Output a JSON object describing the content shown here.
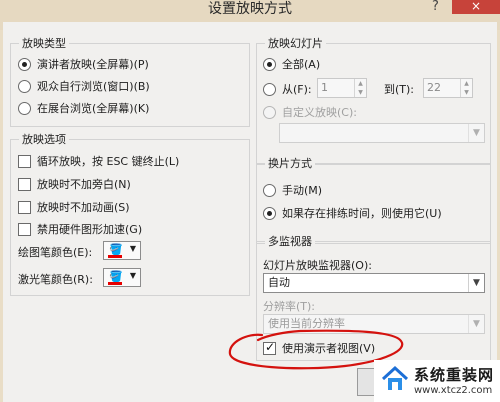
{
  "window": {
    "title": "设置放映方式",
    "help": "?",
    "close": "×"
  },
  "show_type": {
    "title": "放映类型",
    "options": [
      {
        "label": "演讲者放映(全屏幕)(P)",
        "selected": true
      },
      {
        "label": "观众自行浏览(窗口)(B)",
        "selected": false
      },
      {
        "label": "在展台浏览(全屏幕)(K)",
        "selected": false
      }
    ]
  },
  "show_options": {
    "title": "放映选项",
    "checks": [
      {
        "label": "循环放映，按 ESC 键终止(L)",
        "checked": false
      },
      {
        "label": "放映时不加旁白(N)",
        "checked": false
      },
      {
        "label": "放映时不加动画(S)",
        "checked": false
      },
      {
        "label": "禁用硬件图形加速(G)",
        "checked": false
      }
    ],
    "pen_color_label": "绘图笔颜色(E):",
    "laser_color_label": "激光笔颜色(R):",
    "pen_color": "#e60000",
    "laser_color": "#e60000"
  },
  "slides": {
    "title": "放映幻灯片",
    "all_label": "全部(A)",
    "from_label": "从(F):",
    "from_value": "1",
    "to_label": "到(T):",
    "to_value": "22",
    "custom_label": "自定义放映(C):",
    "custom_value": ""
  },
  "advance": {
    "title": "换片方式",
    "options": [
      {
        "label": "手动(M)",
        "selected": false
      },
      {
        "label": "如果存在排练时间，则使用它(U)",
        "selected": true
      }
    ]
  },
  "monitors": {
    "title": "多监视器",
    "monitor_label": "幻灯片放映监视器(O):",
    "monitor_value": "自动",
    "resolution_label": "分辨率(T):",
    "resolution_value": "使用当前分辨率",
    "presenter_view_label": "使用演示者视图(V)",
    "presenter_view_checked": true
  },
  "watermark": {
    "name": "系统重装网",
    "url": "www.xtcz2.com"
  },
  "colors": {
    "annotation": "#d4120e",
    "close": "#c7433a"
  }
}
